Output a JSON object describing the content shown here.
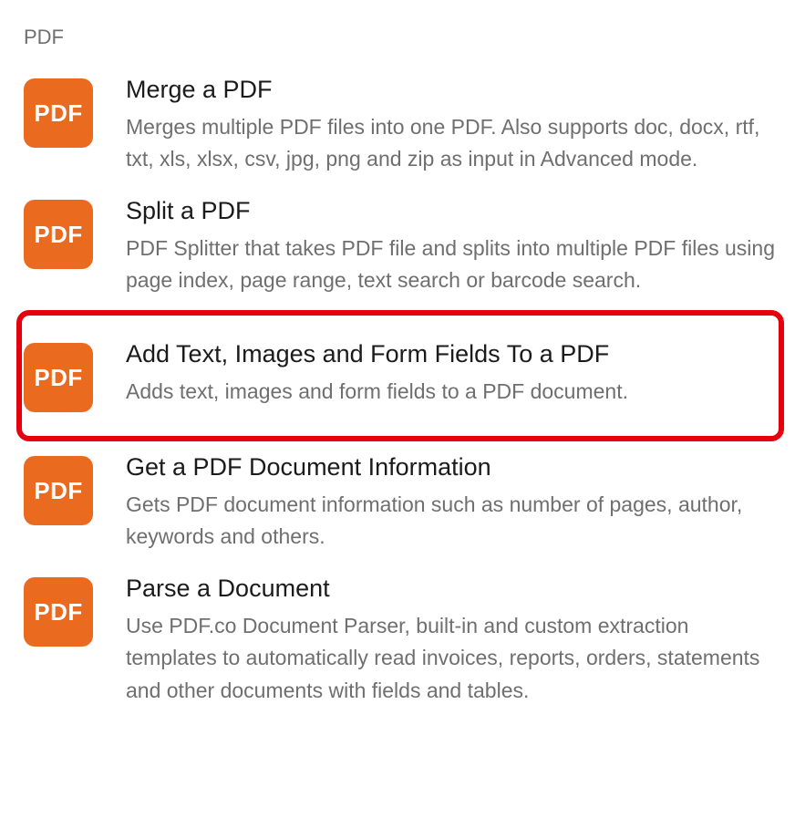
{
  "section": {
    "header": "PDF",
    "icon_text": "PDF",
    "items": [
      {
        "title": "Merge a PDF",
        "description": "Merges multiple PDF files into one PDF. Also supports doc, docx, rtf, txt, xls, xlsx, csv, jpg, png and zip as input in Advanced mode.",
        "highlighted": false
      },
      {
        "title": "Split a PDF",
        "description": "PDF Splitter that takes PDF file and splits into multiple PDF files using page index, page range, text search or barcode search.",
        "highlighted": false
      },
      {
        "title": "Add Text, Images and Form Fields To a PDF",
        "description": "Adds text, images and form fields to a PDF document.",
        "highlighted": true
      },
      {
        "title": "Get a PDF Document Information",
        "description": "Gets PDF document information such as number of pages, author, keywords and others.",
        "highlighted": false
      },
      {
        "title": "Parse a Document",
        "description": "Use PDF.co Document Parser, built-in and custom extraction templates to automatically read invoices, reports, orders, statements and other documents with fields and tables.",
        "highlighted": false
      }
    ]
  }
}
